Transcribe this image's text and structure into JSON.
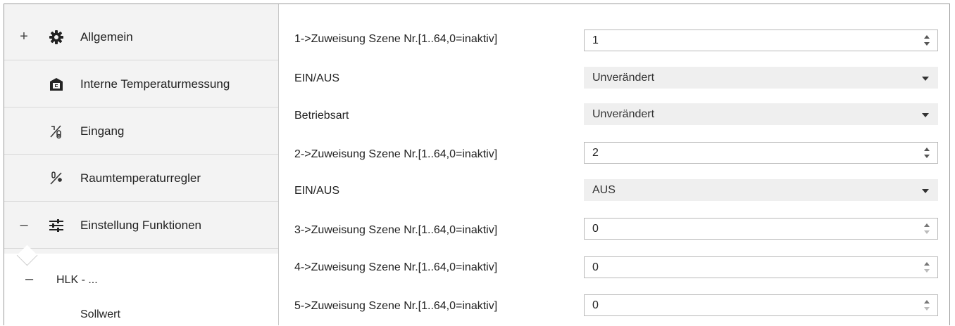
{
  "sidebar": {
    "items": [
      {
        "expander": "+",
        "icon": "gear-icon",
        "label": "Allgemein"
      },
      {
        "expander": "",
        "icon": "thermometer-box-icon",
        "label": "Interne Temperaturmessung"
      },
      {
        "expander": "",
        "icon": "input-sensor-icon",
        "label": "Eingang"
      },
      {
        "expander": "",
        "icon": "room-temperature-icon",
        "label": "Raumtemperaturregler"
      },
      {
        "expander": "–",
        "icon": "sliders-icon",
        "label": "Einstellung Funktionen"
      }
    ],
    "sub": {
      "expander": "–",
      "hlk_label": "HLK - ...",
      "sollwert_label": "Sollwert"
    }
  },
  "params": [
    {
      "label": "1->Zuweisung Szene Nr.[1..64,0=inaktiv]",
      "type": "spin",
      "value": "1"
    },
    {
      "label": "EIN/AUS",
      "type": "drop",
      "value": "Unverändert"
    },
    {
      "label": "Betriebsart",
      "type": "drop",
      "value": "Unverändert"
    },
    {
      "label": "2->Zuweisung Szene Nr.[1..64,0=inaktiv]",
      "type": "spin",
      "value": "2"
    },
    {
      "label": "EIN/AUS",
      "type": "drop",
      "value": "AUS"
    },
    {
      "label": "3->Zuweisung Szene Nr.[1..64,0=inaktiv]",
      "type": "spin",
      "value": "0"
    },
    {
      "label": "4->Zuweisung Szene Nr.[1..64,0=inaktiv]",
      "type": "spin",
      "value": "0"
    },
    {
      "label": "5->Zuweisung Szene Nr.[1..64,0=inaktiv]",
      "type": "spin",
      "value": "0"
    }
  ]
}
